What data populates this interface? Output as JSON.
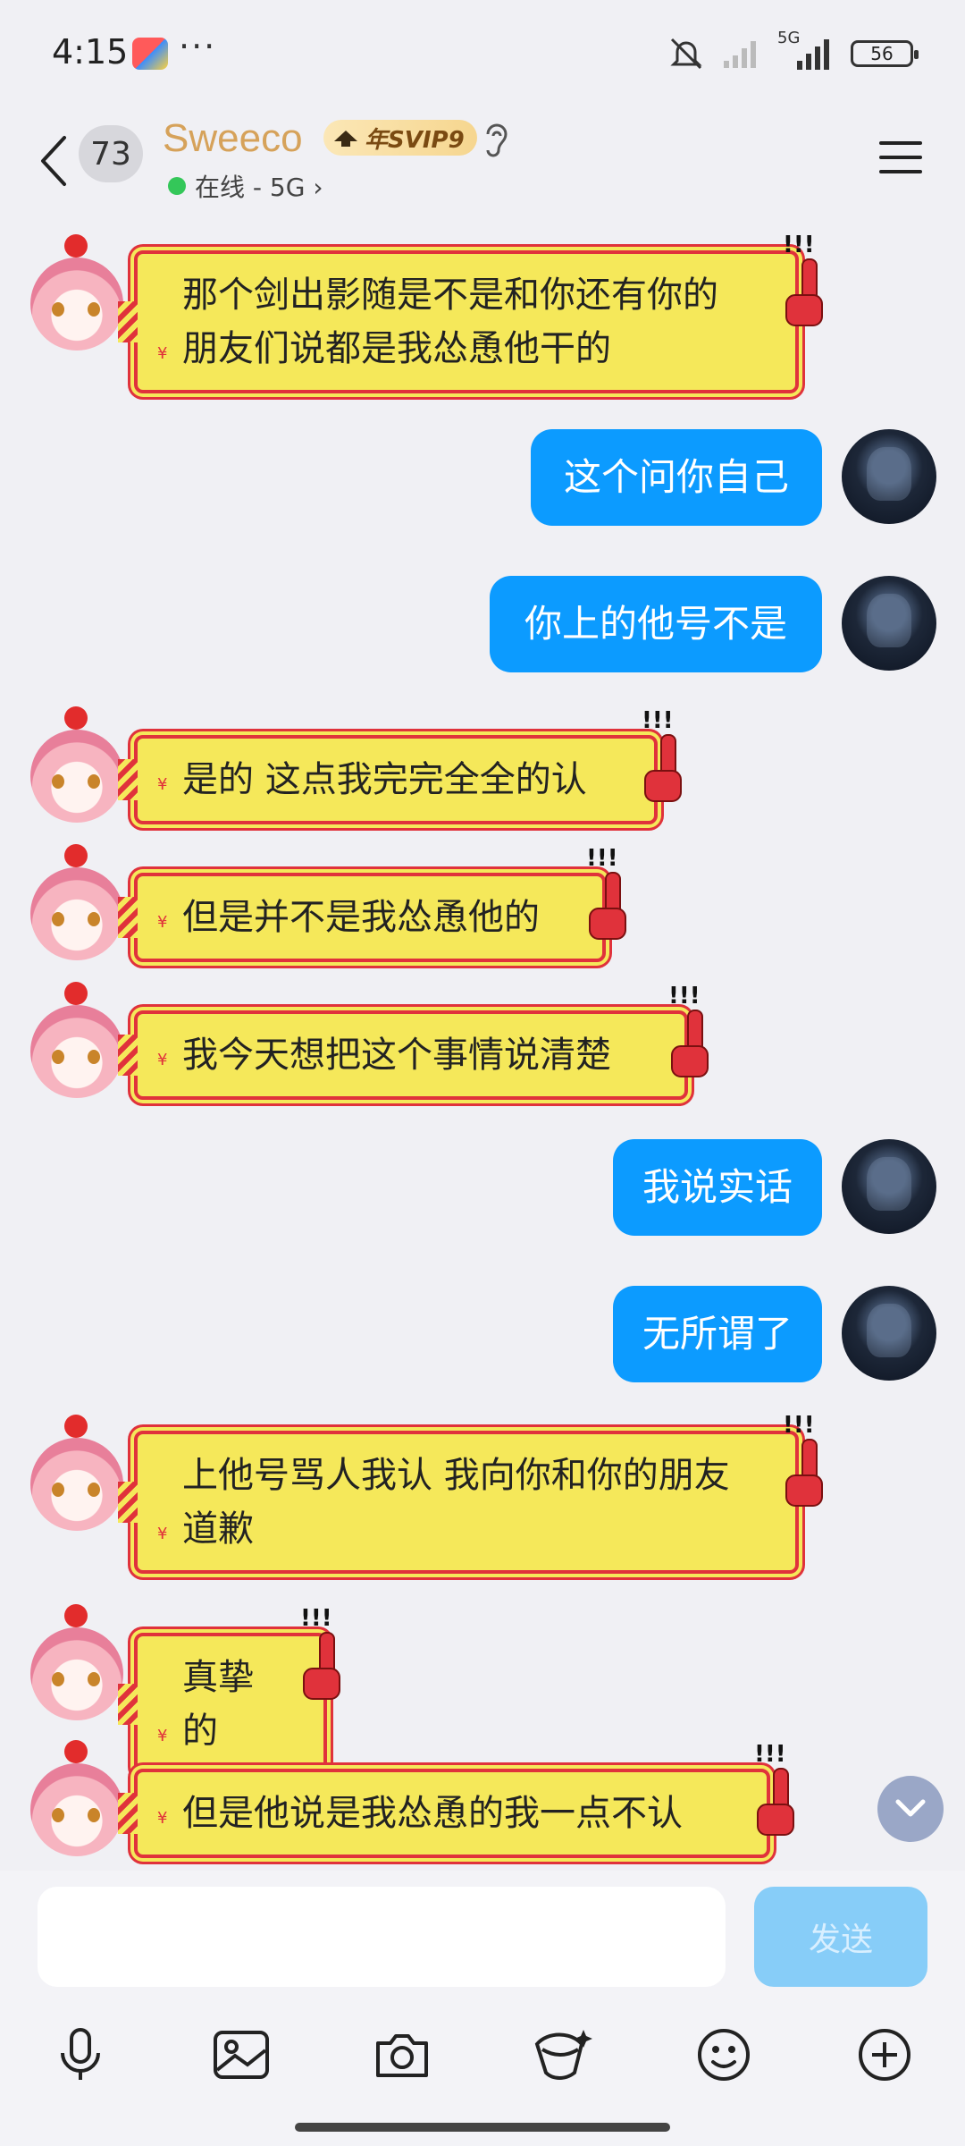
{
  "status_bar": {
    "time": "4:15",
    "more": "···",
    "network": "5G",
    "battery": "56"
  },
  "header": {
    "unread_count": "73",
    "name": "Sweeco",
    "svip_label": "年SVIP9",
    "online_status": "在线 - 5G",
    "status_chevron": "›"
  },
  "messages": [
    {
      "side": "left",
      "text": "那个剑出影随是不是和你还有你的朋友们说都是我怂恿他干的"
    },
    {
      "side": "right",
      "text": "这个问你自己"
    },
    {
      "side": "right",
      "text": "你上的他号不是"
    },
    {
      "side": "left",
      "text": "是的 这点我完完全全的认"
    },
    {
      "side": "left",
      "text": "但是并不是我怂恿他的"
    },
    {
      "side": "left",
      "text": "我今天想把这个事情说清楚"
    },
    {
      "side": "right",
      "text": "我说实话"
    },
    {
      "side": "right",
      "text": "无所谓了"
    },
    {
      "side": "left",
      "text": "上他号骂人我认 我向你和你的朋友道歉"
    },
    {
      "side": "left",
      "text": "真挚的"
    },
    {
      "side": "left",
      "text": "但是他说是我怂恿的我一点不认"
    }
  ],
  "bubble_mark": "¥",
  "input": {
    "value": "",
    "send_label": "发送"
  },
  "toolbar_icons": [
    "microphone-icon",
    "image-icon",
    "camera-icon",
    "red-packet-icon",
    "emoji-icon",
    "plus-icon"
  ],
  "colors": {
    "accent_blue": "#0c9bff",
    "name_gold": "#d6a25a",
    "bubble_yellow": "#f5e85a",
    "bubble_border_red": "#e0323b"
  }
}
